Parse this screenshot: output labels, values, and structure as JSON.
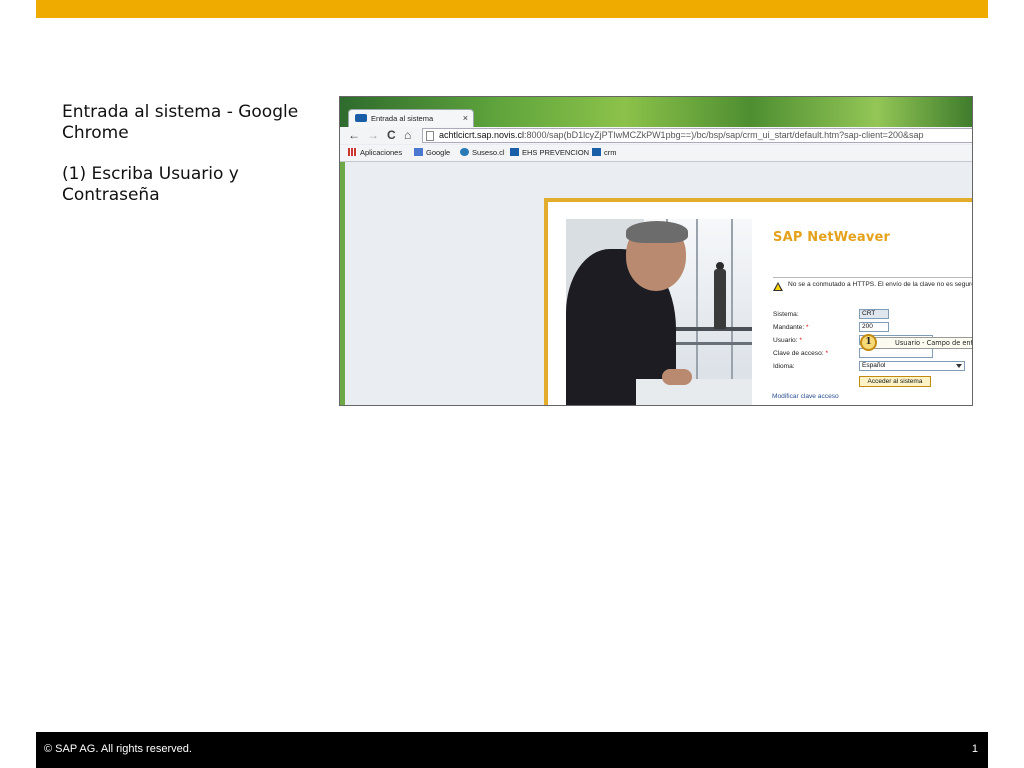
{
  "colors": {
    "accent_bar": "#F0AB00",
    "footer_bg": "#000000",
    "sap_brand": "#E4A21C",
    "login_frame": "#E4AC2C"
  },
  "instructions": {
    "title": "Entrada al sistema - Google Chrome",
    "step": "(1) Escriba Usuario y Contraseña"
  },
  "browser": {
    "tab_title": "Entrada al sistema",
    "tab_close": "×",
    "nav": {
      "back": "←",
      "forward": "→",
      "reload": "C",
      "home": "⌂"
    },
    "url_host": "achtlcicrt.sap.novis.cl",
    "url_rest": ":8000/sap(bD1lcyZjPTIwMCZkPW1pbg==)/bc/bsp/sap/crm_ui_start/default.htm?sap-client=200&sap",
    "bookmarks": [
      "Aplicaciones",
      "Google",
      "Suseso.cl",
      "EHS PREVENCION",
      "crm"
    ]
  },
  "login": {
    "brand": "SAP NetWeaver",
    "warning": "No se a conmutado a HTTPS. El envío de la clave no es seguro.",
    "labels": {
      "sistema": "Sistema:",
      "mandante": "Mandante:",
      "usuario": "Usuario:",
      "clave": "Clave de acceso:",
      "idioma": "Idioma:"
    },
    "required_mark": "*",
    "values": {
      "sistema": "CRT",
      "mandante": "200",
      "idioma": "Español"
    },
    "tooltip": "Usuario - Campo de entrada",
    "step_badge": "1",
    "login_button": "Acceder al sistema",
    "change_password_link": "Modificar clave acceso"
  },
  "footer": {
    "copyright": "©  SAP AG. All rights reserved.",
    "page_number": "1"
  }
}
